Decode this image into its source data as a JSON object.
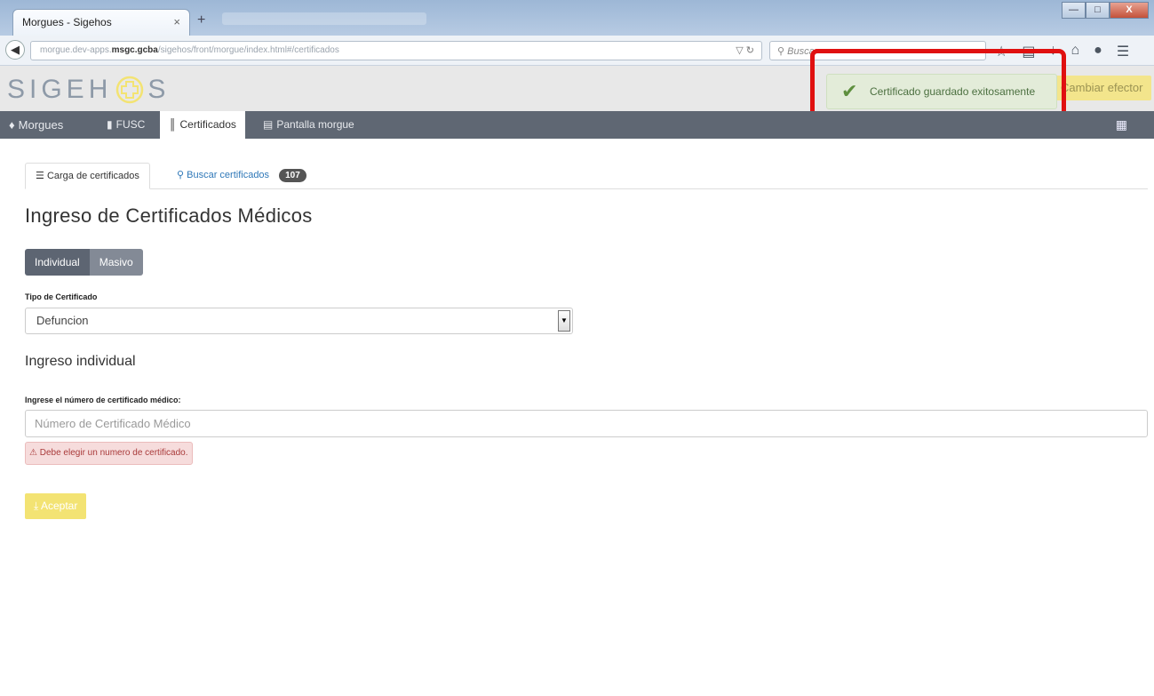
{
  "browser": {
    "tab_title": "Morgues - Sigehos",
    "tab_close": "×",
    "new_tab": "+",
    "url_prefix": "morgue.dev-apps.",
    "url_host": "msgc.gcba",
    "url_path": "/sigehos/front/morgue/index.html#/certificados",
    "search_placeholder": "Buscar",
    "win_min": "—",
    "win_max": "□",
    "win_close": "X"
  },
  "app": {
    "logo_left": "SIGEH",
    "logo_right": "S",
    "cambiar_label": "Cambiar efector"
  },
  "toast": {
    "message": "Certificado guardado exitosamente"
  },
  "menu": {
    "items": [
      {
        "label": "Morgues",
        "icon": "tag-icon"
      },
      {
        "label": "FUSC",
        "icon": "file-icon"
      },
      {
        "label": "Certificados",
        "icon": "barcode-icon"
      },
      {
        "label": "Pantalla morgue",
        "icon": "monitor-icon"
      }
    ]
  },
  "tabs": {
    "carga": "Carga de certificados",
    "buscar": "Buscar certificados",
    "buscar_count": "107"
  },
  "page": {
    "title": "Ingreso de Certificados Médicos",
    "mode_individual": "Individual",
    "mode_masivo": "Masivo",
    "tipo_label": "Tipo de Certificado",
    "tipo_value": "Defuncion",
    "subtitle": "Ingreso individual",
    "numero_label": "Ingrese el número de certificado médico:",
    "numero_placeholder": "Número de Certificado Médico",
    "error": "Debe elegir un numero de certificado.",
    "aceptar": "Aceptar"
  },
  "colors": {
    "menu_bg": "#5f6773",
    "accent_yellow": "#f3e373",
    "toast_bg": "#e3ecd9",
    "highlight": "#e01010"
  }
}
